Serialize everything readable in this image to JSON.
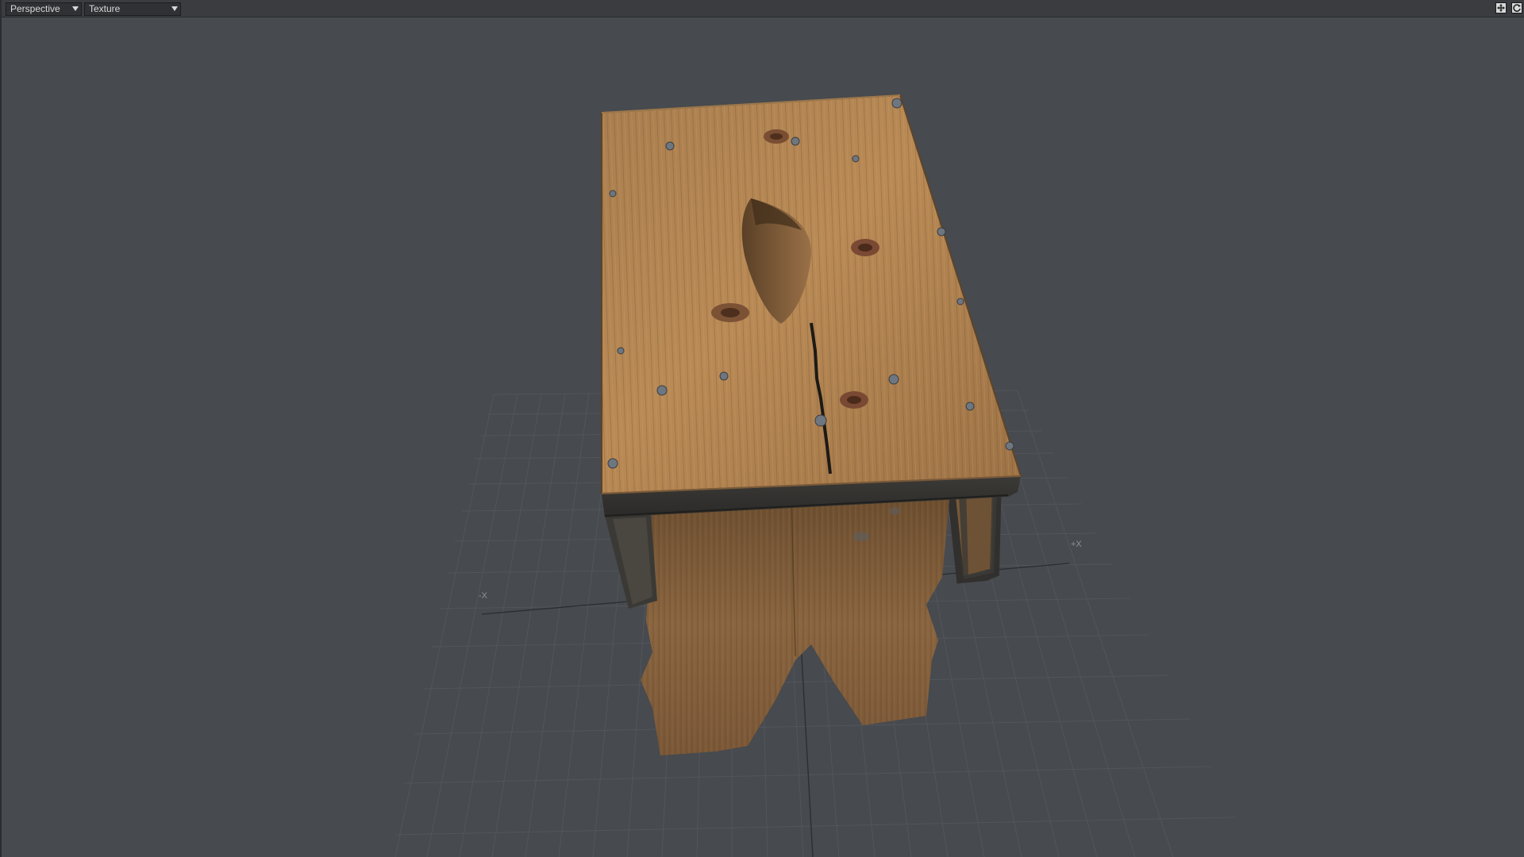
{
  "viewport": {
    "view_mode": "Perspective",
    "render_mode": "Texture",
    "icons": [
      "move-view-icon",
      "rotate-view-icon"
    ],
    "axis_labels": {
      "neg_x": "-X",
      "pos_x": "+X"
    }
  },
  "colors": {
    "background": "#474a4e",
    "toolbar": "#3a3c40",
    "grid_line": "#5a5d62",
    "axis_line": "#2a2c2f",
    "wood_light": "#b08350",
    "wood_dark": "#6e4e2d"
  },
  "scene": {
    "object": "wooden stool"
  }
}
